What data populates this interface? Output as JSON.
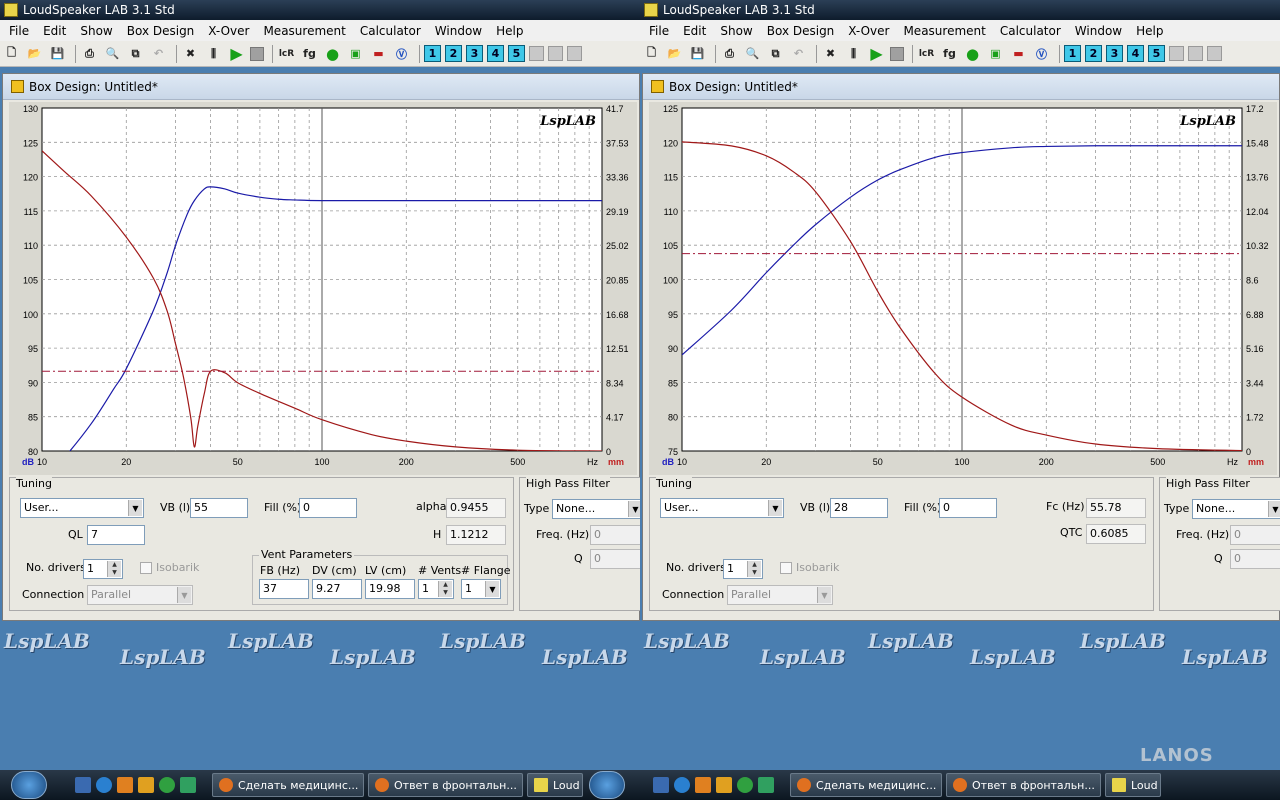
{
  "app_title": "LoudSpeaker LAB 3.1 Std",
  "menu": [
    "File",
    "Edit",
    "Show",
    "Box Design",
    "X-Over",
    "Measurement",
    "Calculator",
    "Window",
    "Help"
  ],
  "toolbar_numbers": [
    "1",
    "2",
    "3",
    "4",
    "5"
  ],
  "window_title": "Box Design: Untitled*",
  "watermark": "LspLAB",
  "colors": {
    "spl_curve": "#1a1aa8",
    "excursion_curve": "#a01818",
    "ref_line": "#a01838"
  },
  "left": {
    "chart_data": {
      "type": "line",
      "x_scale": "log",
      "xlim": [
        10,
        1000
      ],
      "ylim": [
        80,
        130
      ],
      "ylim_right": [
        0,
        41.7
      ],
      "x_ticks": [
        "10",
        "20",
        "50",
        "100",
        "200",
        "500"
      ],
      "x_unit": "Hz",
      "y_ticks": [
        "130",
        "125",
        "120",
        "115",
        "110",
        "105",
        "100",
        "95",
        "90",
        "85",
        "80"
      ],
      "y_unit": "dB",
      "y_right_ticks": [
        "41.7",
        "37.53",
        "33.36",
        "29.19",
        "25.02",
        "20.85",
        "16.68",
        "12.51",
        "8.34",
        "4.17",
        "0"
      ],
      "y_right_unit": "mm",
      "series": [
        {
          "axis": "left",
          "color": "#1a1aa8",
          "x": [
            10,
            12,
            15,
            18,
            20,
            25,
            28,
            30,
            33,
            35,
            38,
            40,
            45,
            50,
            60,
            70,
            80,
            100,
            200,
            500,
            1000
          ],
          "y": [
            75.5,
            79,
            84,
            89,
            92,
            100.5,
            106,
            110,
            114.5,
            116.5,
            118.2,
            118.5,
            118.2,
            117.6,
            117,
            116.7,
            116.6,
            116.5,
            116.5,
            116.5,
            116.5
          ]
        },
        {
          "axis": "right",
          "color": "#a01818",
          "x": [
            10,
            12,
            15,
            20,
            25,
            28,
            30,
            32,
            34,
            35,
            36,
            38,
            40,
            45,
            50,
            60,
            80,
            100,
            150,
            200,
            300,
            500,
            1000
          ],
          "y": [
            36.5,
            34,
            31,
            26,
            21,
            17,
            13,
            9,
            4,
            0.5,
            3,
            7,
            9.7,
            9.5,
            8.3,
            7,
            5.2,
            3.8,
            2,
            1.2,
            0.5,
            0.1,
            0
          ]
        },
        {
          "axis": "right",
          "color": "#a01838",
          "dashed": true,
          "x": [
            10,
            1000
          ],
          "y": [
            9.7,
            9.7
          ]
        }
      ]
    },
    "tuning_label": "Tuning",
    "tuning_value": "User...",
    "vb_label": "VB (l)",
    "vb_value": "55",
    "fill_label": "Fill (%)",
    "fill_value": "0",
    "alpha_label": "alpha",
    "alpha_value": "0.9455",
    "ql_label": "QL",
    "ql_value": "7",
    "h_label": "H",
    "h_value": "1.1212",
    "drivers_label": "No. drivers",
    "drivers_value": "1",
    "isobarik_label": "Isobarik",
    "connection_label": "Connection",
    "connection_value": "Parallel",
    "vent_label": "Vent Parameters",
    "fb_label": "FB (Hz)",
    "fb_value": "37",
    "dv_label": "DV (cm)",
    "dv_value": "9.27",
    "lv_label": "LV (cm)",
    "lv_value": "19.98",
    "vents_label": "# Vents",
    "vents_value": "1",
    "flange_label": "# Flange",
    "flange_value": "1",
    "hpf_label": "High Pass Filter",
    "type_label": "Type",
    "type_value": "None...",
    "freq_label": "Freq. (Hz)",
    "freq_value": "0",
    "q_label": "Q",
    "q_value": "0"
  },
  "right": {
    "chart_data": {
      "type": "line",
      "x_scale": "log",
      "xlim": [
        10,
        1000
      ],
      "ylim": [
        75,
        125
      ],
      "ylim_right": [
        0,
        17.2
      ],
      "x_ticks": [
        "10",
        "20",
        "50",
        "100",
        "200",
        "500"
      ],
      "x_unit": "Hz",
      "y_ticks": [
        "125",
        "120",
        "115",
        "110",
        "105",
        "100",
        "95",
        "90",
        "85",
        "80",
        "75"
      ],
      "y_unit": "dB",
      "y_right_ticks": [
        "17.2",
        "15.48",
        "13.76",
        "12.04",
        "10.32",
        "8.6",
        "6.88",
        "5.16",
        "3.44",
        "1.72",
        "0"
      ],
      "y_right_unit": "mm",
      "series": [
        {
          "axis": "left",
          "color": "#1a1aa8",
          "x": [
            10,
            15,
            20,
            25,
            30,
            40,
            50,
            60,
            80,
            100,
            150,
            200,
            300,
            500,
            1000
          ],
          "y": [
            89,
            95.5,
            101,
            105,
            108,
            112,
            114.5,
            116,
            117.8,
            118.5,
            119.2,
            119.4,
            119.5,
            119.5,
            119.5
          ]
        },
        {
          "axis": "right",
          "color": "#a01818",
          "x": [
            10,
            15,
            20,
            25,
            30,
            40,
            50,
            60,
            80,
            100,
            150,
            200,
            300,
            500,
            1000
          ],
          "y": [
            15.5,
            15.3,
            14.8,
            14,
            13,
            10.5,
            8,
            6.2,
            3.9,
            2.7,
            1.3,
            0.8,
            0.35,
            0.12,
            0.02
          ]
        },
        {
          "axis": "right",
          "color": "#a01838",
          "dashed": true,
          "x": [
            10,
            1000
          ],
          "y": [
            9.9,
            9.9
          ]
        }
      ]
    },
    "tuning_label": "Tuning",
    "tuning_value": "User...",
    "vb_label": "VB (l)",
    "vb_value": "28",
    "fill_label": "Fill (%)",
    "fill_value": "0",
    "fc_label": "Fc (Hz)",
    "fc_value": "55.78",
    "qtc_label": "QTC",
    "qtc_value": "0.6085",
    "drivers_label": "No. drivers",
    "drivers_value": "1",
    "isobarik_label": "Isobarik",
    "connection_label": "Connection",
    "connection_value": "Parallel",
    "hpf_label": "High Pass Filter",
    "type_label": "Type",
    "type_value": "None...",
    "freq_label": "Freq. (Hz)",
    "freq_value": "0",
    "q_label": "Q",
    "q_value": "0"
  },
  "taskbar": {
    "tasks_left": [
      "Сделать медицинс...",
      "Ответ в фронтальн...",
      "Loud"
    ],
    "tasks_right": [
      "Сделать медицинс...",
      "Ответ в фронтальн...",
      "Loud"
    ],
    "brand": "LANOS"
  }
}
